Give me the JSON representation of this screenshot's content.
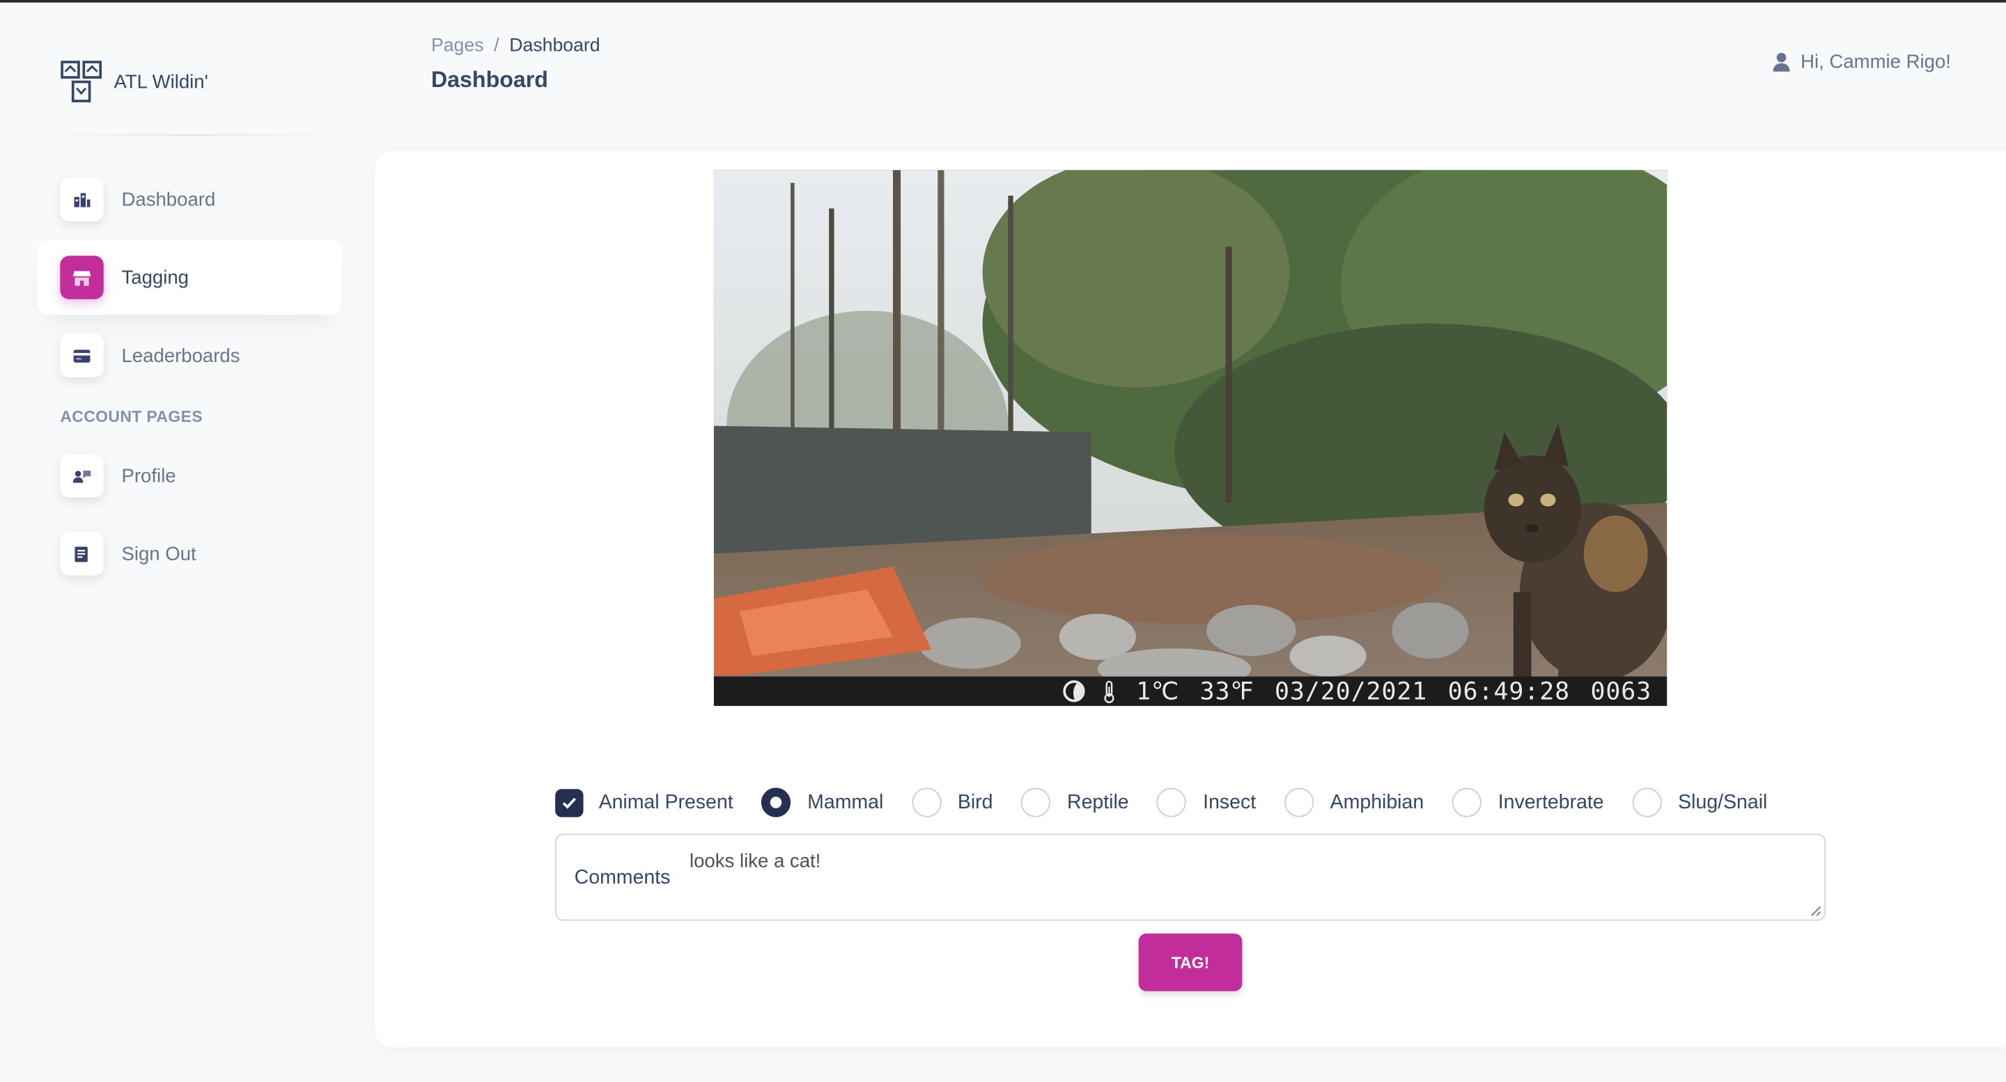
{
  "brand": {
    "name": "ATL Wildin'"
  },
  "sidebar": {
    "items": [
      {
        "label": "Dashboard",
        "icon": "dashboard-icon",
        "active": false
      },
      {
        "label": "Tagging",
        "icon": "store-icon",
        "active": true
      },
      {
        "label": "Leaderboards",
        "icon": "credit-card-icon",
        "active": false
      }
    ],
    "account_heading": "ACCOUNT PAGES",
    "account_items": [
      {
        "label": "Profile",
        "icon": "profile-icon"
      },
      {
        "label": "Sign Out",
        "icon": "document-icon"
      }
    ]
  },
  "header": {
    "breadcrumb": {
      "root": "Pages",
      "separator": "/",
      "current": "Dashboard"
    },
    "title": "Dashboard",
    "greeting": "Hi, Cammie Rigo!"
  },
  "photo": {
    "overlay": {
      "temp_c": "1℃",
      "temp_f": "33℉",
      "date": "03/20/2021",
      "time": "06:49:28",
      "counter": "0063"
    }
  },
  "tagging": {
    "animal_present": {
      "label": "Animal Present",
      "checked": true
    },
    "categories": [
      {
        "label": "Mammal",
        "checked": true
      },
      {
        "label": "Bird",
        "checked": false
      },
      {
        "label": "Reptile",
        "checked": false
      },
      {
        "label": "Insect",
        "checked": false
      },
      {
        "label": "Amphibian",
        "checked": false
      },
      {
        "label": "Invertebrate",
        "checked": false
      },
      {
        "label": "Slug/Snail",
        "checked": false
      }
    ],
    "comments_label": "Comments",
    "comments_value": "looks like a cat!",
    "submit_label": "TAG!"
  },
  "colors": {
    "accent": "#c12d9a",
    "dark": "#252f50",
    "text": "#344767",
    "muted": "#67748e"
  }
}
